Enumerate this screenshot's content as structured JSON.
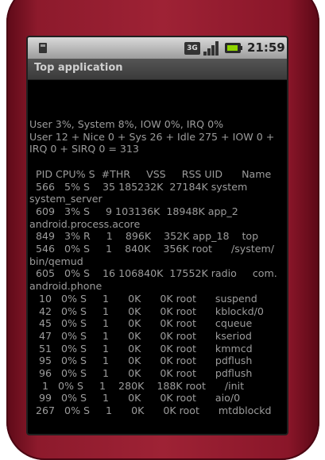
{
  "status_bar": {
    "network": "3G",
    "time": "21:59",
    "icons": [
      "sd-card-icon",
      "network-3g-icon",
      "signal-icon",
      "battery-icon"
    ]
  },
  "title": "Top application",
  "summary": [
    "User 3%, System 8%, IOW 0%, IRQ 0%",
    "User 12 + Nice 0 + Sys 26 + Idle 275 + IOW 0 +",
    "IRQ 0 + SIRQ 0 = 313"
  ],
  "process_lines": [
    "  PID CPU% S  #THR     VSS     RSS UID      Name",
    "  566   5% S    35 185232K  27184K system",
    "system_server",
    "  609   3% S     9 103136K  18948K app_2",
    "android.process.acore",
    "  849   3% R     1    896K    352K app_18    top",
    "  546   0% S     1    840K    356K root      /system/",
    "bin/qemud",
    "  605   0% S    16 106840K  17552K radio     com.",
    "android.phone",
    "   10   0% S     1      0K      0K root      suspend",
    "   42   0% S     1      0K      0K root      kblockd/0",
    "   45   0% S     1      0K      0K root      cqueue",
    "   47   0% S     1      0K      0K root      kseriod",
    "   51   0% S     1      0K      0K root      kmmcd",
    "   95   0% S     1      0K      0K root      pdflush",
    "   96   0% S     1      0K      0K root      pdflush",
    "    1   0% S     1    280K    188K root      /init",
    "   99   0% S     1      0K      0K root      aio/0",
    "  267   0% S     1      0K      0K root      mtdblockd"
  ]
}
